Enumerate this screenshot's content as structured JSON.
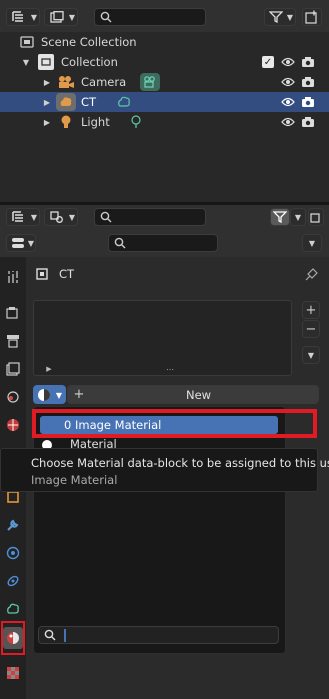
{
  "outliner": {
    "scene_collection": "Scene Collection",
    "collection": "Collection",
    "objects": [
      {
        "label": "Camera"
      },
      {
        "label": "CT"
      },
      {
        "label": "Light"
      }
    ]
  },
  "properties": {
    "object_name": "CT",
    "new_button": "New",
    "selected_material": "0 Image Material",
    "dropdown_item": "Material",
    "tooltip": {
      "title": "Choose Material data-block to be assigned to this user",
      "value": "Image Material"
    }
  },
  "colors": {
    "selection": "#334d80",
    "highlight_red": "#e01b24",
    "accent_blue": "#4772b3"
  }
}
